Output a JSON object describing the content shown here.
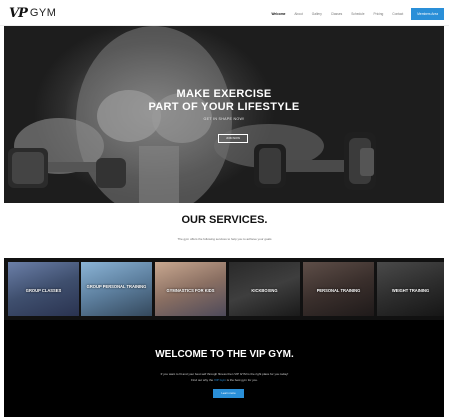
{
  "brand": {
    "mark": "VP",
    "name": "GYM"
  },
  "nav": {
    "items": [
      "Welcome",
      "About",
      "Gallery",
      "Classes",
      "Schedule",
      "Pricing",
      "Contact"
    ],
    "cta": "Members Area"
  },
  "hero": {
    "title_line1": "MAKE EXERCISE",
    "title_line2": "PART OF YOUR LIFESTYLE",
    "subtitle": "GET IN SHAPE NOW!",
    "button": "JOIN NOW"
  },
  "services": {
    "title": "OUR SERVICES.",
    "subtitle": "The gym offers the following services to help you to achieve your goals",
    "items": [
      {
        "label": "GROUP CLASSES"
      },
      {
        "label": "GROUP PERSONAL TRAINING"
      },
      {
        "label": "GYMNASTICS FOR KIDS"
      },
      {
        "label": "KICKBOXING"
      },
      {
        "label": "PERSONAL TRAINING"
      },
      {
        "label": "WEIGHT TRAINING"
      }
    ]
  },
  "welcome": {
    "title": "WELCOME TO THE VIP GYM.",
    "line1": "If you want to fit and your best self through fitness then VIP GYM is the right place for you today!",
    "line2_pre": "Find out why the ",
    "line2_link": "VIP Gym",
    "line2_post": " is the best gym for you.",
    "button": "Learn more"
  },
  "colors": {
    "accent": "#2a8fd8",
    "dark": "#000000",
    "text": "#111111"
  }
}
